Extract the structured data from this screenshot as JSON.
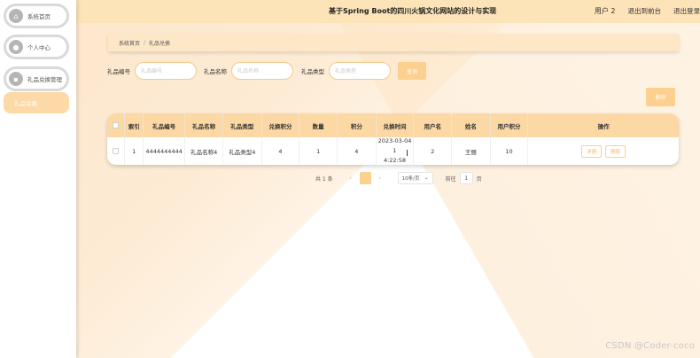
{
  "app": {
    "title": "基于Spring Boot的四川火锅文化网站的设计与实现"
  },
  "header": {
    "user_label": "用户 2",
    "back_to_admin": "退出到前台",
    "logout": "退出登录"
  },
  "sidebar": {
    "items": [
      {
        "label": "系统首页",
        "icon": "home-icon"
      },
      {
        "label": "个人中心",
        "icon": "user-icon"
      },
      {
        "label": "礼品兑换管理",
        "icon": "list-icon"
      }
    ],
    "submenu": {
      "label": "礼品兑换",
      "active": true
    }
  },
  "breadcrumb": {
    "home": "系统首页",
    "separator": "/",
    "current": "礼品兑换"
  },
  "search": {
    "no_label": "礼品编号",
    "no_placeholder": "礼品编号",
    "name_label": "礼品名称",
    "name_placeholder": "礼品名称",
    "type_label": "礼品类型",
    "type_placeholder": "礼品类型",
    "query_button": "查询"
  },
  "toolbar": {
    "delete_button": "删除"
  },
  "table": {
    "headers": [
      "索引",
      "礼品编号",
      "礼品名称",
      "礼品类型",
      "兑换积分",
      "数量",
      "积分",
      "兑换时间",
      "用户名",
      "姓名",
      "用户积分",
      "操作"
    ],
    "rows": [
      {
        "index": "1",
        "gift_no": "4444444444",
        "gift_name": "礼品名称4",
        "gift_type": "礼品类型4",
        "exchange_points": "4",
        "quantity": "1",
        "points": "4",
        "time_line1": "2023-03-04 1",
        "time_line2": "4:22:58",
        "username": "2",
        "real_name": "王丽",
        "user_points": "10",
        "detail_button": "详情",
        "delete_button": "删除"
      }
    ]
  },
  "pagination": {
    "total": "共 1 条",
    "current_page": "1",
    "page_size": "10条/页",
    "goto_label": "前往",
    "goto_value": "1",
    "goto_suffix": "页"
  },
  "watermark": "CSDN @Coder-coco",
  "colors": {
    "accent": "#fcd08e",
    "header": "#fce3b8",
    "table_header": "#fcd8a5"
  }
}
